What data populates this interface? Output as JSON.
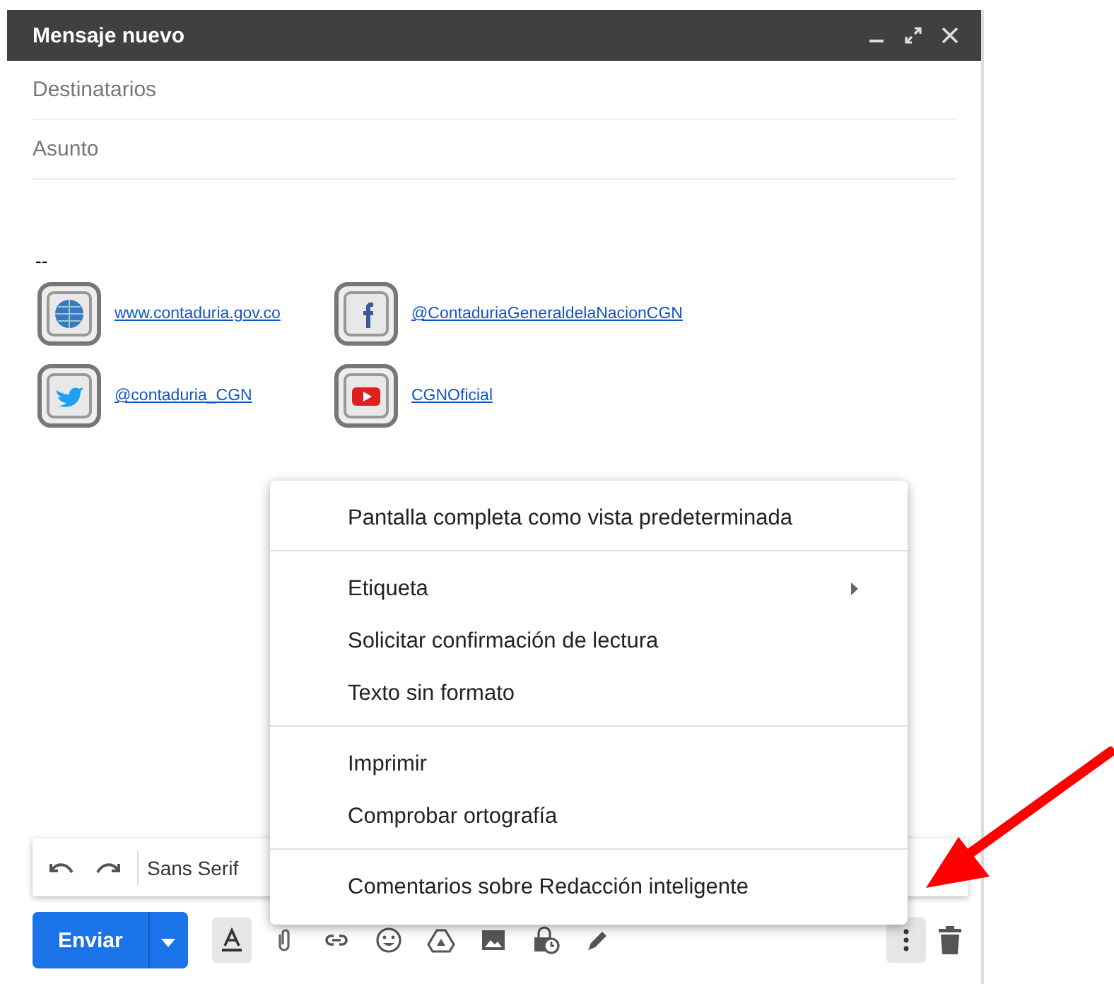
{
  "window": {
    "title": "Mensaje nuevo"
  },
  "fields": [
    {
      "placeholder": "Destinatarios"
    },
    {
      "placeholder": "Asunto"
    }
  ],
  "body": {
    "separator": "--",
    "signature": [
      {
        "kind": "web",
        "link": "www.contaduria.gov.co"
      },
      {
        "kind": "facebook",
        "link": "@ContaduriaGeneraldelaNacionCGN"
      },
      {
        "kind": "twitter",
        "link": "@contaduria_CGN"
      },
      {
        "kind": "youtube",
        "link": "CGNOficial"
      }
    ]
  },
  "format_toolbar": {
    "font": "Sans Serif"
  },
  "send_button": {
    "label": "Enviar"
  },
  "bottom_tools": [
    {
      "kind": "format",
      "selected": true
    },
    {
      "kind": "attach",
      "selected": false
    },
    {
      "kind": "link",
      "selected": false
    },
    {
      "kind": "emoji",
      "selected": false
    },
    {
      "kind": "drive",
      "selected": false
    },
    {
      "kind": "photo",
      "selected": false
    },
    {
      "kind": "confidential",
      "selected": false
    },
    {
      "kind": "signature",
      "selected": false
    }
  ],
  "more_button": {
    "selected": true
  },
  "menu": {
    "sections": [
      [
        {
          "label": "Pantalla completa como vista predeterminada",
          "submenu": false
        }
      ],
      [
        {
          "label": "Etiqueta",
          "submenu": true
        },
        {
          "label": "Solicitar confirmación de lectura",
          "submenu": false
        },
        {
          "label": "Texto sin formato",
          "submenu": false
        }
      ],
      [
        {
          "label": "Imprimir",
          "submenu": false
        },
        {
          "label": "Comprobar ortografía",
          "submenu": false
        }
      ],
      [
        {
          "label": "Comentarios sobre Redacción inteligente",
          "submenu": false
        }
      ]
    ]
  }
}
